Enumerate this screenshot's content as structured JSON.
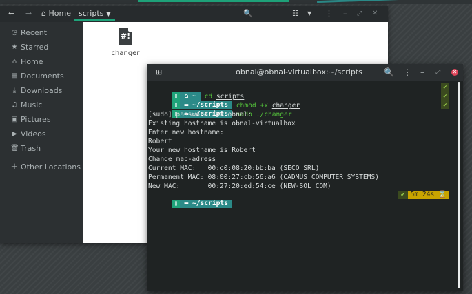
{
  "file_manager": {
    "nav": {
      "back": "←",
      "forward": "→",
      "home_icon": "home-icon",
      "home_label": "Home"
    },
    "path_label": "scripts",
    "toolbar": {
      "search": "🔍",
      "view": "☷",
      "menu": "⋮",
      "minimize": "–",
      "maximize": "⤢",
      "close": "✕"
    },
    "sidebar": [
      {
        "icon": "recent-icon",
        "glyph": "◷",
        "label": "Recent"
      },
      {
        "icon": "star-icon",
        "glyph": "★",
        "label": "Starred"
      },
      {
        "icon": "home-icon",
        "glyph": "⌂",
        "label": "Home"
      },
      {
        "icon": "documents-icon",
        "glyph": "▤",
        "label": "Documents"
      },
      {
        "icon": "download-icon",
        "glyph": "⤓",
        "label": "Downloads"
      },
      {
        "icon": "music-icon",
        "glyph": "♫",
        "label": "Music"
      },
      {
        "icon": "pictures-icon",
        "glyph": "▣",
        "label": "Pictures"
      },
      {
        "icon": "video-icon",
        "glyph": "▶",
        "label": "Videos"
      },
      {
        "icon": "trash-icon",
        "glyph": "🗑",
        "label": "Trash"
      },
      {
        "icon": "plus-icon",
        "glyph": "+",
        "label": "Other Locations"
      }
    ],
    "files": [
      {
        "name": "changer",
        "icon": "script-file-icon",
        "glyph": "#!"
      }
    ]
  },
  "terminal": {
    "title": "obnal@obnal-virtualbox:~/scripts",
    "prompts": [
      {
        "path": "~",
        "cmd_pre": "cd ",
        "cmd_arg": "scripts",
        "status": "✔"
      },
      {
        "path": "~/scripts",
        "cmd_pre": "chmod +x ",
        "cmd_arg": "changer",
        "status": "✔"
      },
      {
        "path": "~/scripts",
        "cmd_pre": "sudo ./changer",
        "cmd_arg": "",
        "status": "✔"
      }
    ],
    "output": [
      "[sudo] password for obnal:",
      "Existing hostname is obnal-virtualbox",
      "Enter new hostname:",
      "Robert",
      "Your new hostname is Robert",
      "Change mac-adress",
      "Current MAC:   00:c0:08:20:bb:ba (SECO SRL)",
      "Permanent MAC: 08:00:27:cb:56:a6 (CADMUS COMPUTER SYSTEMS)",
      "New MAC:       00:27:20:ed:54:ce (NEW-SOL COM)"
    ],
    "last_prompt": {
      "path": "~/scripts",
      "status": "✔",
      "elapsed": "5m 24s",
      "hourglass": "⌛"
    }
  }
}
